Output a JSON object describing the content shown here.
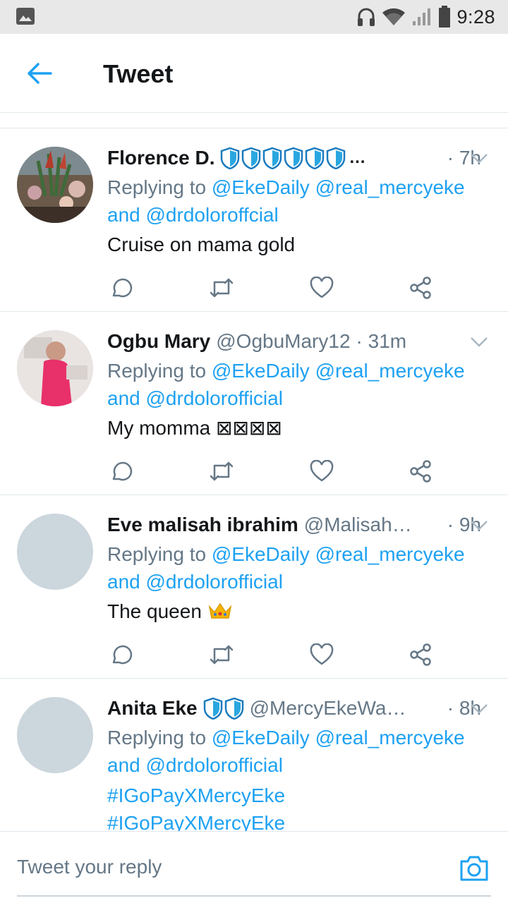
{
  "status_bar": {
    "time": "9:28",
    "icons": [
      "gallery-icon",
      "headphones-icon",
      "wifi-icon",
      "signal-icon",
      "battery-icon"
    ]
  },
  "header": {
    "title": "Tweet",
    "back_icon": "arrow-left-icon"
  },
  "colors": {
    "accent": "#1da1f2",
    "text": "#14171a",
    "secondary": "#657786",
    "divider": "#e1e8ed",
    "status_bar": "#e8e8e8"
  },
  "tweets": [
    {
      "name": "Florence D.",
      "badges": 6,
      "badge_ellipsis": "…",
      "handle": "",
      "time": "· 7h",
      "replying_prefix": "Replying to",
      "mention_1": "@EkeDaily",
      "mention_2": "@real_mercyeke",
      "and_word": "and",
      "mention_3": "@drdoloroffcial",
      "text": "Cruise on mama gold"
    },
    {
      "name": "Ogbu Mary",
      "handle": "@OgbuMary12",
      "time": "· 31m",
      "replying_prefix": "Replying to",
      "mention_1": "@EkeDaily",
      "mention_2": "@real_mercyeke",
      "and_word": "and",
      "mention_3": "@drdolorofficial",
      "text": "My momma ⊠⊠⊠⊠"
    },
    {
      "name": "Eve malisah ibrahim",
      "handle": "@Malisah…",
      "time": "· 9h",
      "replying_prefix": "Replying to",
      "mention_1": "@EkeDaily",
      "mention_2": "@real_mercyeke",
      "and_word": "and",
      "mention_3": "@drdolorofficial",
      "text": "The queen",
      "emoji": "crown-icon"
    },
    {
      "name": "Anita Eke",
      "badges": 2,
      "handle": "@MercyEkeWa…",
      "time": "· 8h",
      "replying_prefix": "Replying to",
      "mention_1": "@EkeDaily",
      "mention_2": "@real_mercyeke",
      "and_word": "and",
      "mention_3": "@drdolorofficial",
      "hashtag_1": "#IGoPayXMercyEke",
      "hashtag_2": "#IGoPayXMercyEke"
    }
  ],
  "reply_bar": {
    "placeholder": "Tweet your reply",
    "camera_icon": "camera-icon"
  }
}
